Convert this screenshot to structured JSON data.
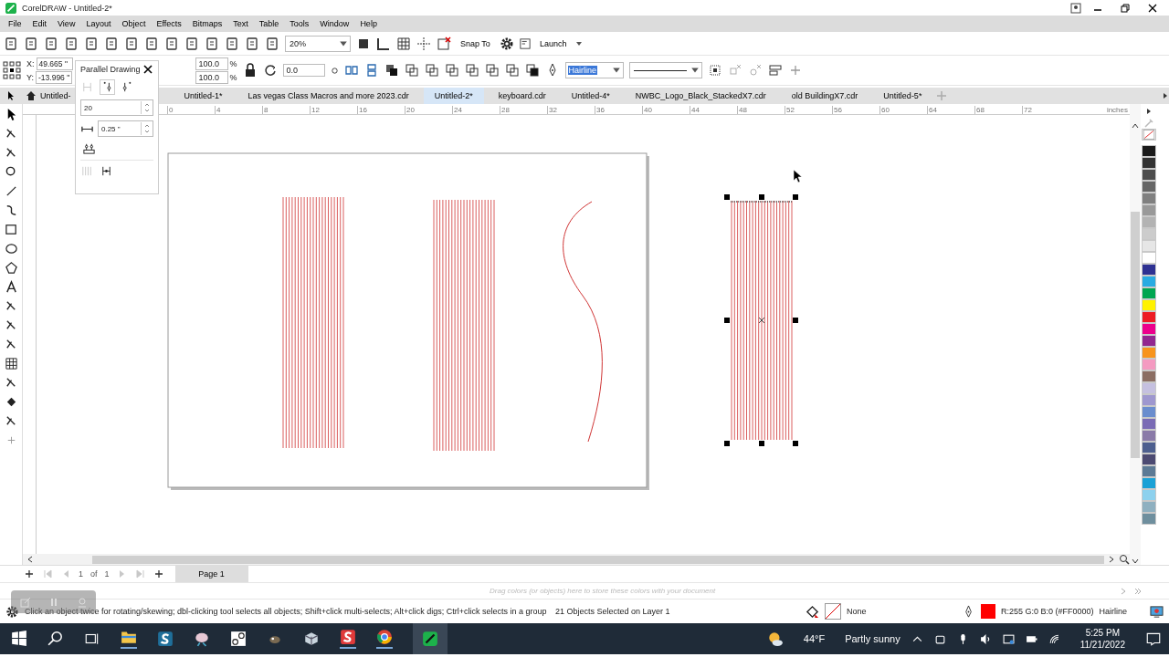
{
  "window": {
    "title": "CorelDRAW - Untitled-2*"
  },
  "menu": [
    "File",
    "Edit",
    "View",
    "Layout",
    "Object",
    "Effects",
    "Bitmaps",
    "Text",
    "Table",
    "Tools",
    "Window",
    "Help"
  ],
  "toolbar": {
    "zoom": "20%",
    "snap": "Snap To",
    "launch": "Launch"
  },
  "property_bar": {
    "x_label": "X:",
    "x": "49.665 \"",
    "y_label": "Y:",
    "y": "-13.996 \"",
    "scale_w": "100.0",
    "scale_h": "100.0",
    "percent_w": "%",
    "percent_h": "%",
    "angle": "0.0",
    "outline_width": "Hairline"
  },
  "docker": {
    "title": "Parallel Drawing",
    "count": "20",
    "distance": "0.25 \""
  },
  "tabs": [
    {
      "label": "Untitled-",
      "selected": false
    },
    {
      "label": "Untitled-1*",
      "selected": false
    },
    {
      "label": "Las vegas Class Macros and more 2023.cdr",
      "selected": false
    },
    {
      "label": "Untitled-2*",
      "selected": true
    },
    {
      "label": "keyboard.cdr",
      "selected": false
    },
    {
      "label": "Untitled-4*",
      "selected": false
    },
    {
      "label": "NWBC_Logo_Black_StackedX7.cdr",
      "selected": false
    },
    {
      "label": "old BuildingX7.cdr",
      "selected": false
    },
    {
      "label": "Untitled-5*",
      "selected": false
    }
  ],
  "ruler": {
    "labels": [
      "0",
      "4",
      "8",
      "12",
      "16",
      "20",
      "24",
      "28",
      "32",
      "36",
      "40",
      "44",
      "48",
      "52",
      "56",
      "60",
      "64",
      "68",
      "72"
    ],
    "unit": "inches"
  },
  "palette": [
    {
      "kind": "none"
    },
    {
      "kind": "color",
      "color": "#1a1a1a"
    },
    {
      "kind": "color",
      "color": "#333333"
    },
    {
      "kind": "color",
      "color": "#4d4d4d"
    },
    {
      "kind": "color",
      "color": "#666666"
    },
    {
      "kind": "color",
      "color": "#808080"
    },
    {
      "kind": "color",
      "color": "#999999"
    },
    {
      "kind": "color",
      "color": "#b3b3b3"
    },
    {
      "kind": "color",
      "color": "#cccccc"
    },
    {
      "kind": "color",
      "color": "#e6e6e6"
    },
    {
      "kind": "color",
      "color": "#ffffff"
    },
    {
      "kind": "color",
      "color": "#2e3192"
    },
    {
      "kind": "color",
      "color": "#29abe2"
    },
    {
      "kind": "color",
      "color": "#00a651"
    },
    {
      "kind": "color",
      "color": "#fff200"
    },
    {
      "kind": "color",
      "color": "#ed1c24"
    },
    {
      "kind": "color",
      "color": "#ec008c"
    },
    {
      "kind": "color",
      "color": "#92278f"
    },
    {
      "kind": "color",
      "color": "#f7941d"
    },
    {
      "kind": "color",
      "color": "#f49ac1"
    },
    {
      "kind": "color",
      "color": "#8c6e63"
    },
    {
      "kind": "color",
      "color": "#c5c0e0"
    },
    {
      "kind": "color",
      "color": "#9e97cf"
    },
    {
      "kind": "color",
      "color": "#6a8dce"
    },
    {
      "kind": "color",
      "color": "#7a6bb5"
    },
    {
      "kind": "color",
      "color": "#8a7aa8"
    },
    {
      "kind": "color",
      "color": "#4d5f8f"
    },
    {
      "kind": "color",
      "color": "#4c4a72"
    },
    {
      "kind": "color",
      "color": "#5c7a95"
    },
    {
      "kind": "color",
      "color": "#1ba1d6"
    },
    {
      "kind": "color",
      "color": "#8dd1ee"
    },
    {
      "kind": "color",
      "color": "#8fb0c0"
    },
    {
      "kind": "color",
      "color": "#6f8f9e"
    }
  ],
  "page_nav": {
    "current": "1",
    "of": "of",
    "total": "1",
    "page_tab": "Page 1"
  },
  "color_drawer": {
    "hint": "Drag colors (or objects) here to store these colors with your document"
  },
  "status_bar": {
    "hint": "Click an object twice for rotating/skewing; dbl-clicking tool selects all objects; Shift+click multi-selects; Alt+click digs; Ctrl+click selects in a group",
    "selection": "21 Objects Selected on Layer 1",
    "fill": "None",
    "outline_color": "R:255 G:0 B:0 (#FF0000)",
    "outline_width": "Hairline"
  },
  "taskbar": {
    "temperature": "44°F",
    "weather": "Partly sunny",
    "time": "5:25 PM",
    "date": "11/21/2022"
  }
}
